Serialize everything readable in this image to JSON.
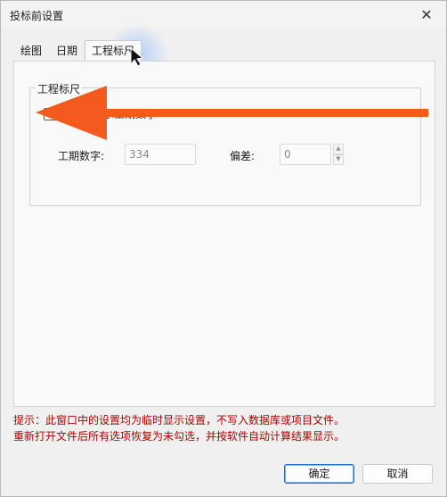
{
  "window": {
    "title": "投标前设置",
    "close_glyph": "✕"
  },
  "tabs": [
    {
      "label": "绘图",
      "active": false
    },
    {
      "label": "日期",
      "active": false
    },
    {
      "label": "工程标尺",
      "active": true
    }
  ],
  "group": {
    "legend": "工程标尺",
    "checkbox_label": "标尺栏显示工期数字",
    "checkbox_checked": false,
    "duration_label": "工期数字:",
    "duration_value": "334",
    "offset_label": "偏差:",
    "offset_value": "0"
  },
  "hint": {
    "line1": "提示：此窗口中的设置均为临时显示设置，不写入数据库或项目文件。",
    "line2": "重新打开文件后所有选项恢复为未勾选，并按软件自动计算结果显示。"
  },
  "buttons": {
    "ok": "确定",
    "cancel": "取消"
  },
  "annotation": {
    "arrow_color": "#f45a1e"
  },
  "icons": {
    "close": "close-icon",
    "cursor": "mouse-cursor-icon",
    "spin_up": "spin-up-icon",
    "spin_down": "spin-down-icon"
  }
}
